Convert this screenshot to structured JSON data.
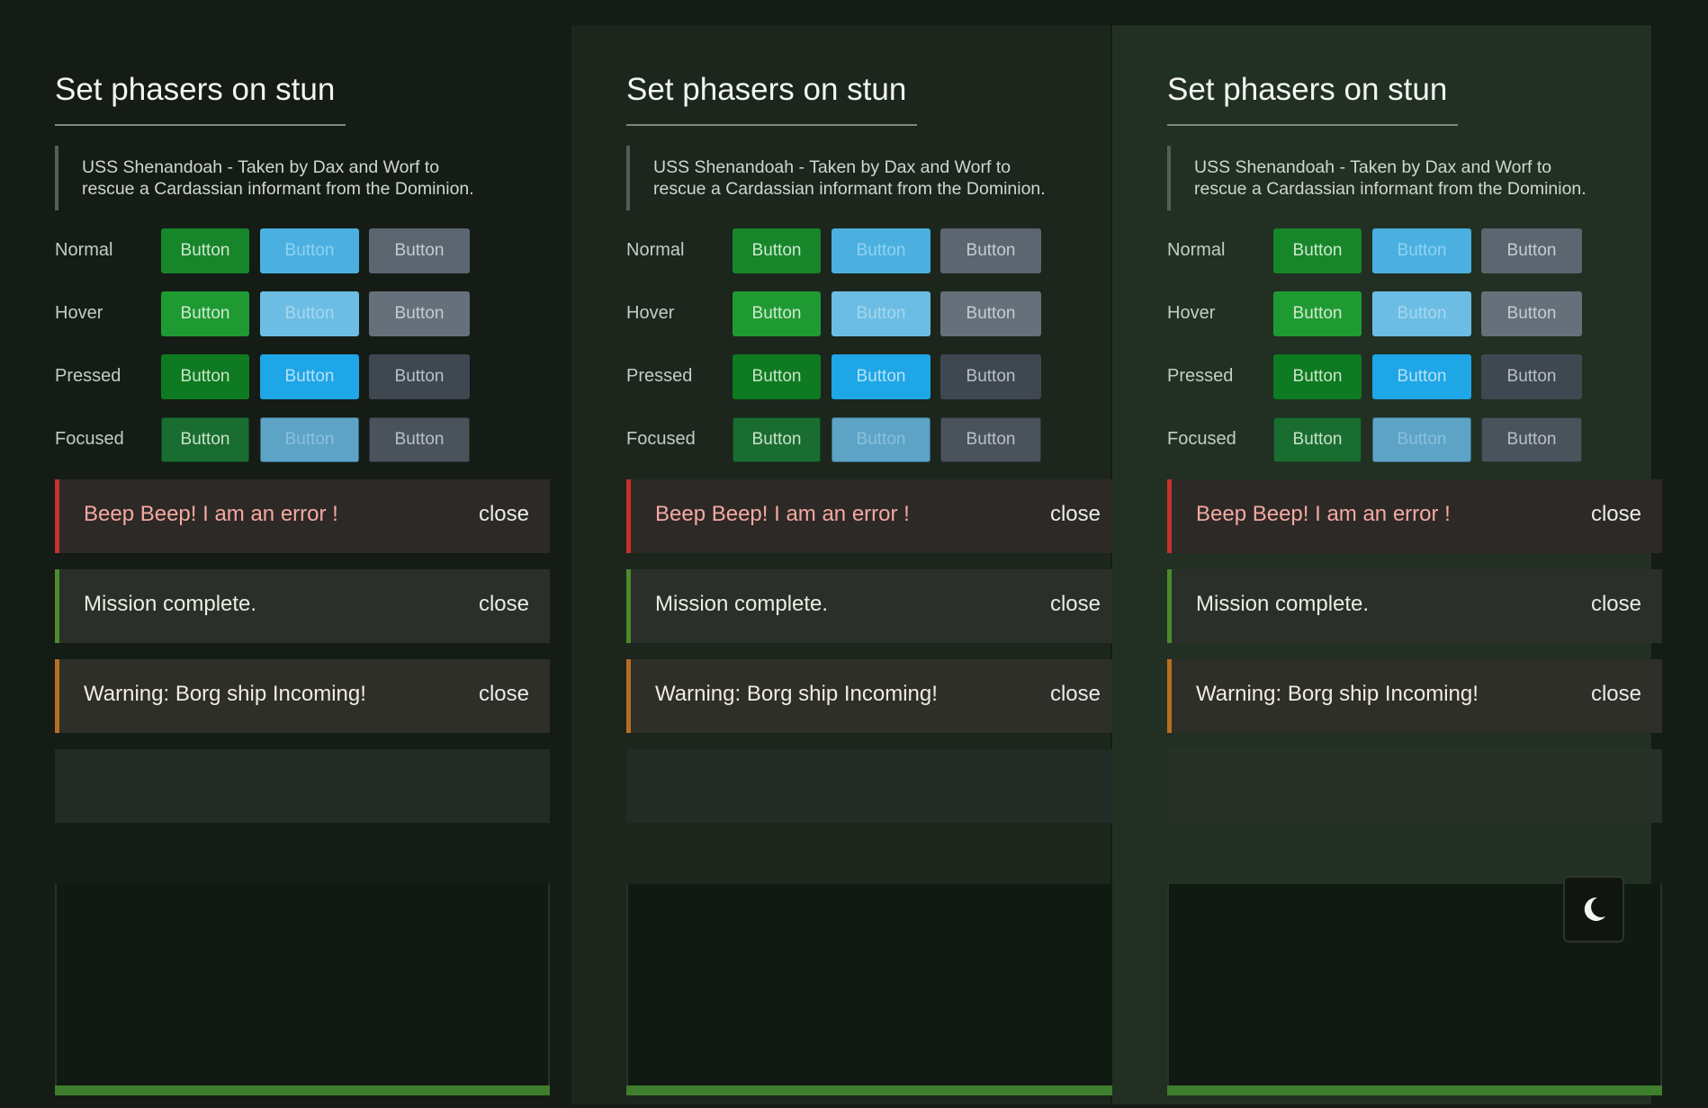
{
  "panels": [
    {
      "title": "Set phasers on stun",
      "quote": "USS Shenandoah - Taken by Dax and Worf to rescue a Cardassian informant from the Dominion.",
      "rows": [
        {
          "label": "Normal",
          "buttons": [
            "Button",
            "Button",
            "Button"
          ]
        },
        {
          "label": "Hover",
          "buttons": [
            "Button",
            "Button",
            "Button"
          ]
        },
        {
          "label": "Pressed",
          "buttons": [
            "Button",
            "Button",
            "Button"
          ]
        },
        {
          "label": "Focused",
          "buttons": [
            "Button",
            "Button",
            "Button"
          ]
        }
      ],
      "alerts": [
        {
          "type": "error",
          "message": "Beep Beep! I am an error !",
          "close": "close"
        },
        {
          "type": "success",
          "message": "Mission complete.",
          "close": "close"
        },
        {
          "type": "warning",
          "message": "Warning: Borg ship Incoming!",
          "close": "close"
        }
      ]
    },
    {
      "title": "Set phasers on stun",
      "quote": "USS Shenandoah - Taken by Dax and Worf to rescue a Cardassian informant from the Dominion.",
      "rows": [
        {
          "label": "Normal",
          "buttons": [
            "Button",
            "Button",
            "Button"
          ]
        },
        {
          "label": "Hover",
          "buttons": [
            "Button",
            "Button",
            "Button"
          ]
        },
        {
          "label": "Pressed",
          "buttons": [
            "Button",
            "Button",
            "Button"
          ]
        },
        {
          "label": "Focused",
          "buttons": [
            "Button",
            "Button",
            "Button"
          ]
        }
      ],
      "alerts": [
        {
          "type": "error",
          "message": "Beep Beep! I am an error !",
          "close": "close"
        },
        {
          "type": "success",
          "message": "Mission complete.",
          "close": "close"
        },
        {
          "type": "warning",
          "message": "Warning: Borg ship Incoming!",
          "close": "close"
        }
      ]
    },
    {
      "title": "Set phasers on stun",
      "quote": "USS Shenandoah - Taken by Dax and Worf to rescue a Cardassian informant from the Dominion.",
      "rows": [
        {
          "label": "Normal",
          "buttons": [
            "Button",
            "Button",
            "Button"
          ]
        },
        {
          "label": "Hover",
          "buttons": [
            "Button",
            "Button",
            "Button"
          ]
        },
        {
          "label": "Pressed",
          "buttons": [
            "Button",
            "Button",
            "Button"
          ]
        },
        {
          "label": "Focused",
          "buttons": [
            "Button",
            "Button",
            "Button"
          ]
        }
      ],
      "alerts": [
        {
          "type": "error",
          "message": "Beep Beep! I am an error !",
          "close": "close"
        },
        {
          "type": "success",
          "message": "Mission complete.",
          "close": "close"
        },
        {
          "type": "warning",
          "message": "Warning: Borg ship Incoming!",
          "close": "close"
        }
      ]
    }
  ],
  "theme_toggle_icon": "moon-icon",
  "colors": {
    "page_bg": "#141c15",
    "panel_bgs": [
      "#141c15",
      "#1c261d",
      "#213022"
    ],
    "error": "#c7302e",
    "success": "#4c8b2b",
    "warning": "#b66e21",
    "progress": "#3f7e2c",
    "button_green": "#1a8a2c",
    "button_blue": "#4aaedc",
    "button_slate": "#5b6570"
  }
}
